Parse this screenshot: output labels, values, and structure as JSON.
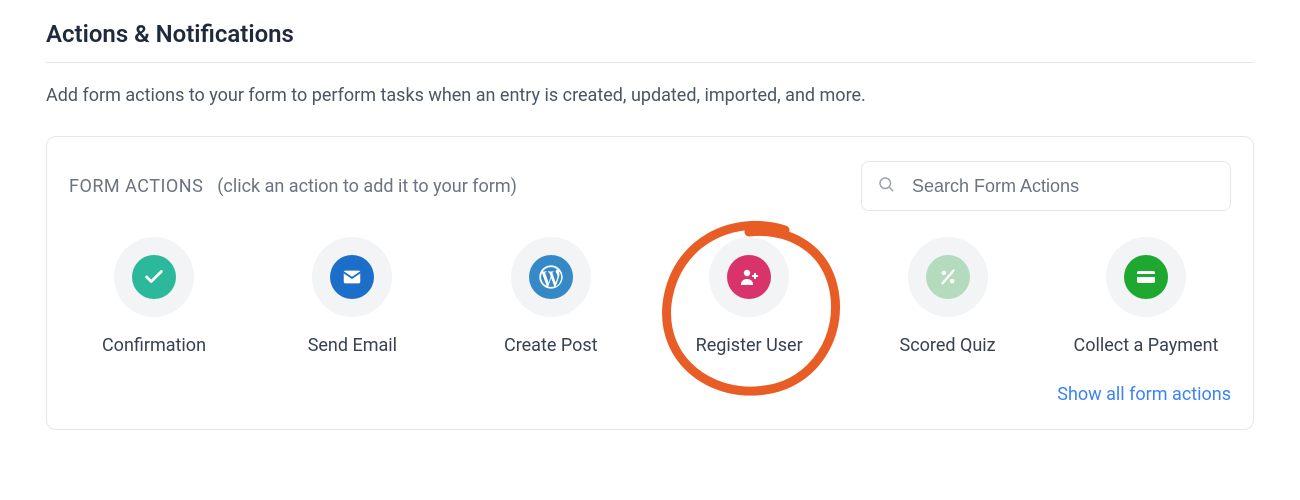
{
  "header": {
    "title": "Actions & Notifications",
    "subtitle": "Add form actions to your form to perform tasks when an entry is created, updated, imported, and more."
  },
  "panel": {
    "section_title": "FORM ACTIONS",
    "hint": "(click an action to add it to your form)",
    "search_placeholder": "Search Form Actions",
    "show_all_label": "Show all form actions"
  },
  "actions": [
    {
      "label": "Confirmation",
      "icon": "checkmark-icon",
      "color": "#2bb89b"
    },
    {
      "label": "Send Email",
      "icon": "envelope-icon",
      "color": "#1d6ec9"
    },
    {
      "label": "Create Post",
      "icon": "wordpress-icon",
      "color": "#3589c6"
    },
    {
      "label": "Register User",
      "icon": "user-add-icon",
      "color": "#d9336c",
      "highlighted": true
    },
    {
      "label": "Scored Quiz",
      "icon": "percent-icon",
      "color": "#b4dbbd"
    },
    {
      "label": "Collect a Payment",
      "icon": "credit-card-icon",
      "color": "#1fa82f"
    }
  ],
  "colors": {
    "accent_link": "#3b82f6",
    "annotation": "#e85d25"
  }
}
